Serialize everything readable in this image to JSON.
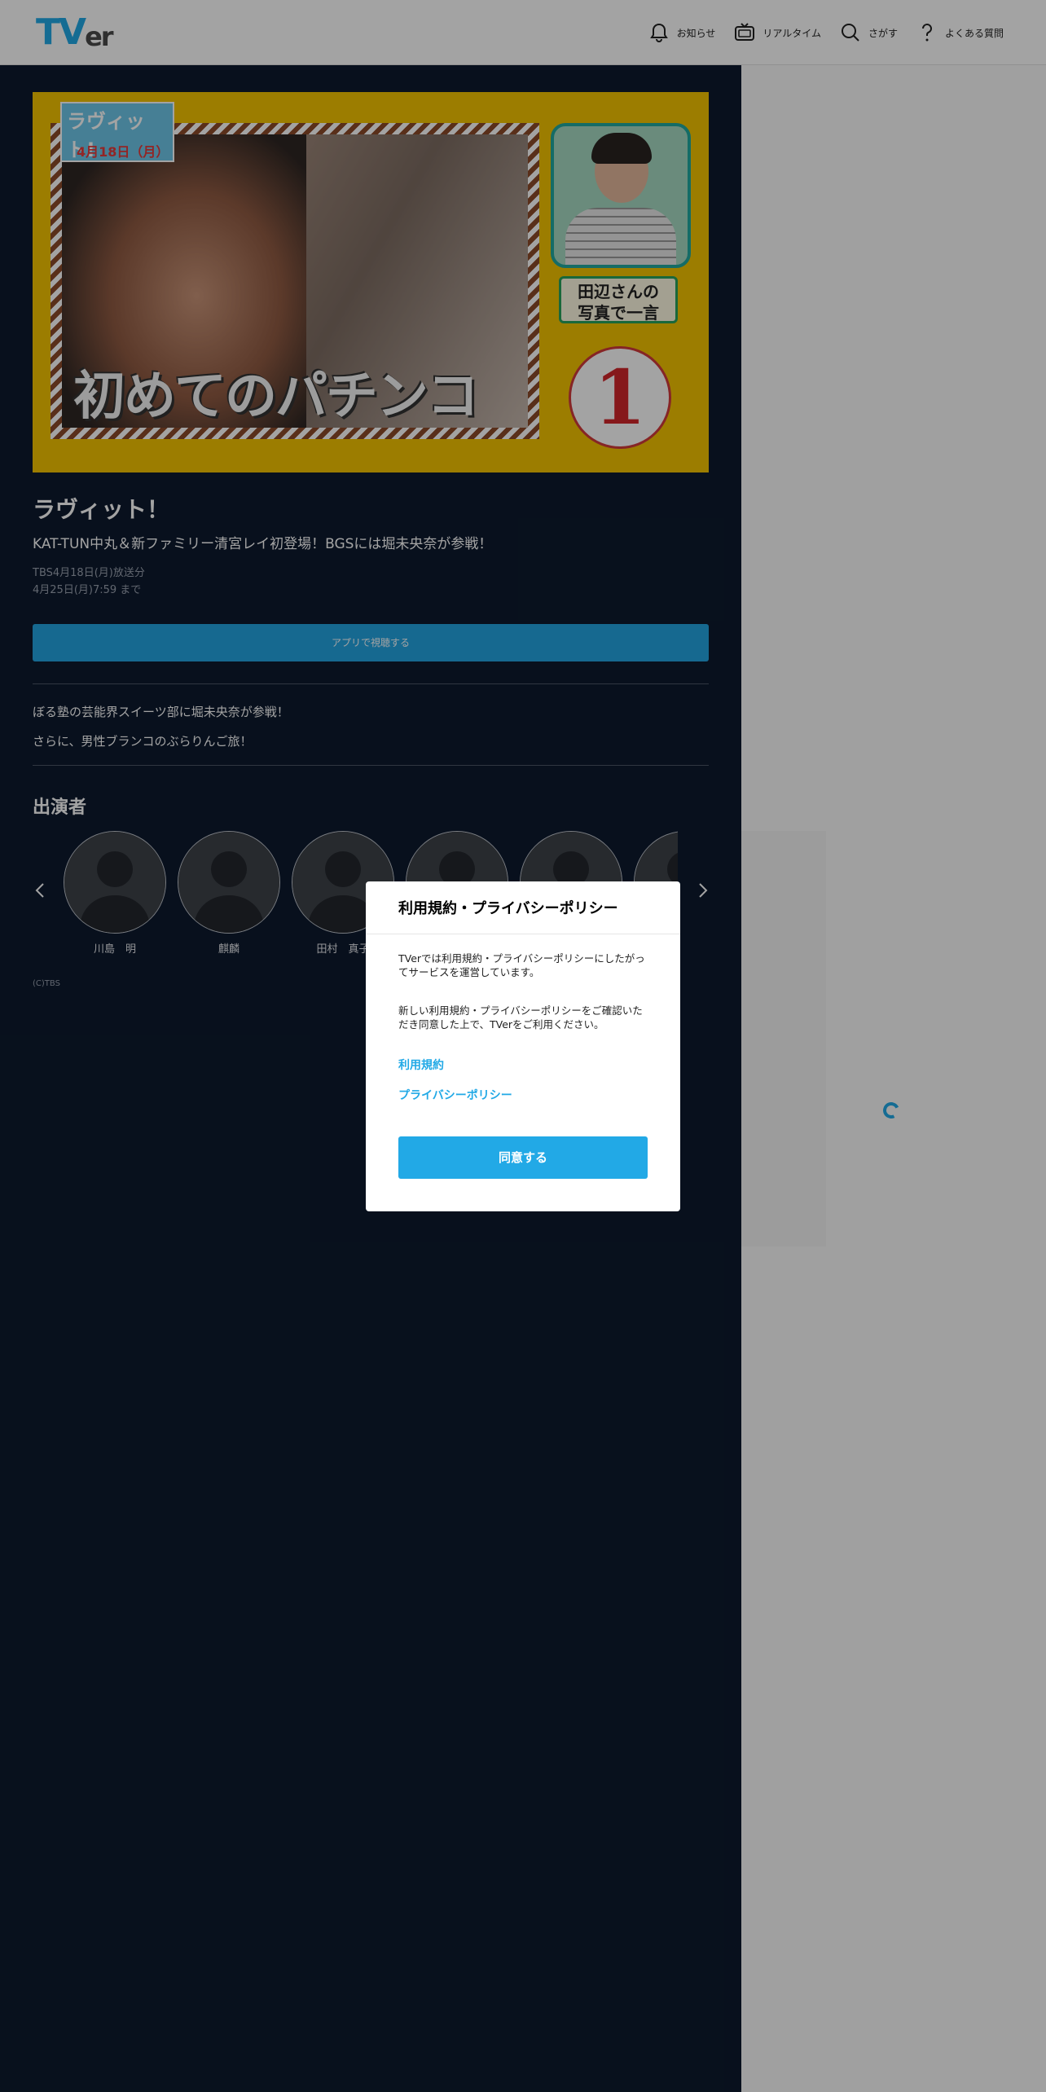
{
  "header": {
    "logo_main": "TV",
    "logo_sub": "er",
    "nav": [
      {
        "label": "お知らせ",
        "icon": "bell-icon"
      },
      {
        "label": "リアルタイム",
        "icon": "tv-icon"
      },
      {
        "label": "さがす",
        "icon": "search-icon"
      },
      {
        "label": "よくある質問",
        "icon": "question-icon"
      }
    ]
  },
  "hero": {
    "badge_title": "ラヴィット!",
    "badge_date": "4月18日（月）",
    "caption": "初めてのパチンコ",
    "tag_line1": "田辺さんの",
    "tag_line2": "写真で一言",
    "rank": "1"
  },
  "program": {
    "title": "ラヴィット！",
    "subtitle": "KAT-TUN中丸＆新ファミリー清宮レイ初登場！BGSには堀未央奈が参戦！",
    "broadcast": "TBS4月18日(月)放送分",
    "expiry": "4月25日(月)7:59 まで",
    "watch_button": "アプリで視聴する",
    "description_1": "ぼる塾の芸能界スイーツ部に堀未央奈が参戦！",
    "description_2": "さらに、男性ブランコのぶらりんご旅！"
  },
  "cast": {
    "heading": "出演者",
    "members": [
      "川島　明",
      "麒麟",
      "田村　真子",
      "",
      "",
      ""
    ]
  },
  "copyright": "(C)TBS",
  "modal": {
    "title": "利用規約・プライバシーポリシー",
    "body_1": "TVerでは利用規約・プライバシーポリシーにしたがってサービスを運営しています。",
    "body_2": "新しい利用規約・プライバシーポリシーをご確認いただき同意した上で、TVerをご利用ください。",
    "link_terms": "利用規約",
    "link_privacy": "プライバシーポリシー",
    "agree_button": "同意する"
  },
  "colors": {
    "accent": "#22a9e6",
    "main_bg": "#0d1a2e",
    "hero_bg": "#f5c400"
  }
}
